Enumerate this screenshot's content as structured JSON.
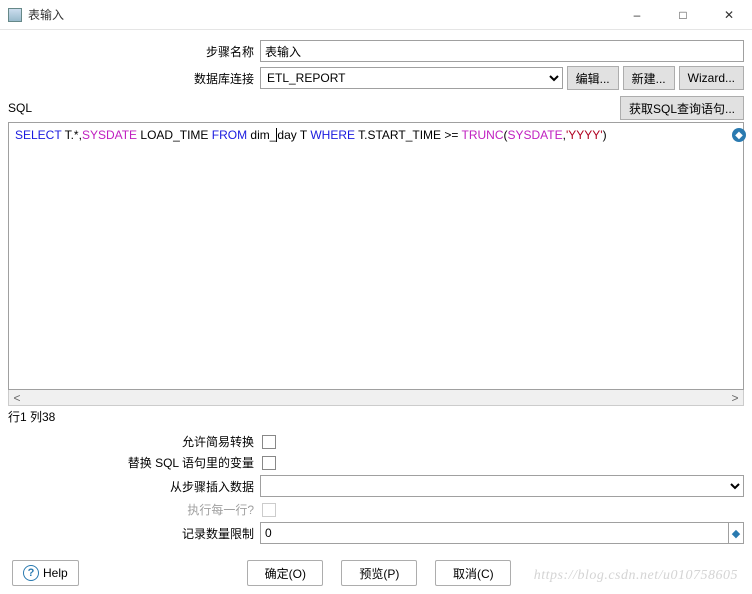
{
  "window": {
    "title": "表输入",
    "minimize": "–",
    "maximize": "□",
    "close": "✕"
  },
  "form": {
    "step_name_label": "步骤名称",
    "step_name_value": "表输入",
    "db_conn_label": "数据库连接",
    "db_conn_value": "ETL_REPORT",
    "edit_btn": "编辑...",
    "new_btn": "新建...",
    "wizard_btn": "Wizard..."
  },
  "sql": {
    "label": "SQL",
    "get_sql_btn": "获取SQL查询语句...",
    "tokens": [
      {
        "t": "SELECT",
        "c": "kw"
      },
      {
        "t": " T.*,",
        "c": "plain"
      },
      {
        "t": "SYSDATE",
        "c": "fn"
      },
      {
        "t": " LOAD_TIME ",
        "c": "plain"
      },
      {
        "t": "FROM",
        "c": "kw"
      },
      {
        "t": " dim_",
        "c": "plain"
      },
      {
        "t": "|",
        "c": "caret"
      },
      {
        "t": "day T ",
        "c": "plain"
      },
      {
        "t": "WHERE",
        "c": "kw"
      },
      {
        "t": " T.START_TIME >= ",
        "c": "plain"
      },
      {
        "t": "TRUNC",
        "c": "fn"
      },
      {
        "t": "(",
        "c": "plain"
      },
      {
        "t": "SYSDATE",
        "c": "fn"
      },
      {
        "t": ",",
        "c": "plain"
      },
      {
        "t": "'YYYY'",
        "c": "str"
      },
      {
        "t": ")",
        "c": "plain"
      }
    ],
    "status": "行1 列38"
  },
  "options": {
    "lazy_label": "允许简易转换",
    "replace_vars_label": "替换 SQL 语句里的变量",
    "from_step_label": "从步骤插入数据",
    "from_step_value": "",
    "exec_each_row_label": "执行每一行?",
    "record_limit_label": "记录数量限制",
    "record_limit_value": "0"
  },
  "footer": {
    "help": "Help",
    "ok": "确定(O)",
    "preview": "预览(P)",
    "cancel": "取消(C)"
  },
  "watermark": "https://blog.csdn.net/u010758605"
}
